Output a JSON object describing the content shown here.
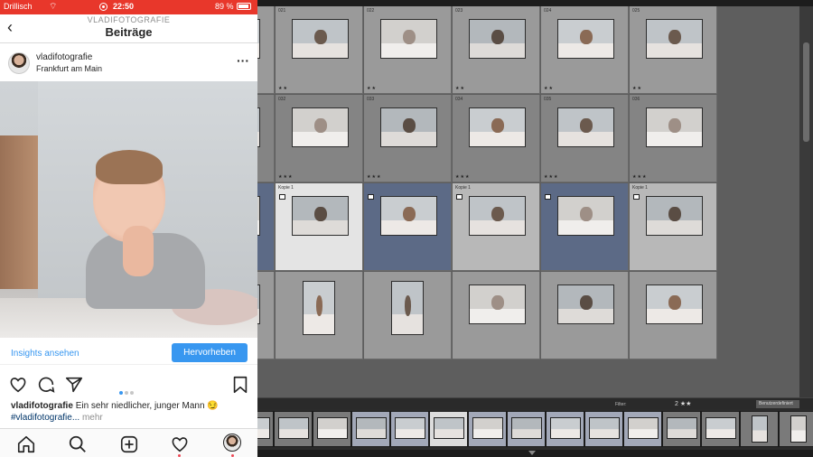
{
  "status_bar": {
    "carrier": "Drillisch",
    "time": "22:50",
    "battery": "89 %"
  },
  "instagram": {
    "header": {
      "username": "VLADIFOTOGRAFIE",
      "title": "Beiträge"
    },
    "post": {
      "author": "vladifotografie",
      "location": "Frankfurt am Main",
      "insights_link": "Insights ansehen",
      "promote_button": "Hervorheben",
      "carousel_index": 1,
      "carousel_count": 3,
      "caption_user": "vladifotografie",
      "caption_text": "Ein sehr niedlicher, junger Mann 😏",
      "caption_tag": "#vladifotografie...",
      "caption_more": "mehr"
    },
    "icons": {
      "back": "chevron-left-icon",
      "options": "more-horizontal-icon",
      "like": "heart-icon",
      "comment": "comment-icon",
      "share": "paper-plane-icon",
      "save": "bookmark-icon"
    },
    "tabs": [
      "home-icon",
      "search-icon",
      "add-post-icon",
      "activity-heart-icon",
      "profile-avatar"
    ]
  },
  "lightroom": {
    "grid_rows": [
      {
        "cells": [
          {
            "num": "",
            "style": "normal",
            "stars": ""
          },
          {
            "num": "021",
            "style": "normal",
            "stars": "★★"
          },
          {
            "num": "022",
            "style": "normal",
            "stars": "★★"
          },
          {
            "num": "023",
            "style": "normal",
            "stars": "★★"
          },
          {
            "num": "024",
            "style": "normal",
            "stars": "★★"
          },
          {
            "num": "025",
            "style": "normal",
            "stars": "★★"
          }
        ]
      },
      {
        "cells": [
          {
            "num": "",
            "style": "dark",
            "stars": ""
          },
          {
            "num": "032",
            "style": "dark",
            "stars": "★★★"
          },
          {
            "num": "033",
            "style": "dark",
            "stars": "★★★"
          },
          {
            "num": "034",
            "style": "dark",
            "stars": "★★★"
          },
          {
            "num": "035",
            "style": "dark",
            "stars": "★★★"
          },
          {
            "num": "036",
            "style": "dark",
            "stars": "★★★"
          }
        ]
      },
      {
        "cells": [
          {
            "num": "",
            "style": "sel",
            "stars": ""
          },
          {
            "num": "Kopie 1",
            "style": "white",
            "stars": ""
          },
          {
            "num": "",
            "style": "sel",
            "stars": ""
          },
          {
            "num": "Kopie 1",
            "style": "lite",
            "stars": ""
          },
          {
            "num": "",
            "style": "sel",
            "stars": ""
          },
          {
            "num": "Kopie 1",
            "style": "lite",
            "stars": ""
          }
        ]
      },
      {
        "cells": [
          {
            "num": "",
            "style": "normal",
            "stars": ""
          },
          {
            "num": "",
            "style": "normal",
            "stars": ""
          },
          {
            "num": "",
            "style": "normal",
            "stars": ""
          },
          {
            "num": "",
            "style": "normal",
            "stars": ""
          },
          {
            "num": "",
            "style": "normal",
            "stars": ""
          },
          {
            "num": "",
            "style": "normal",
            "stars": ""
          }
        ]
      }
    ],
    "filter_label": "Filter:",
    "filter_stars": "2 ★★",
    "filter_preset": "Benutzerdefiniert"
  }
}
